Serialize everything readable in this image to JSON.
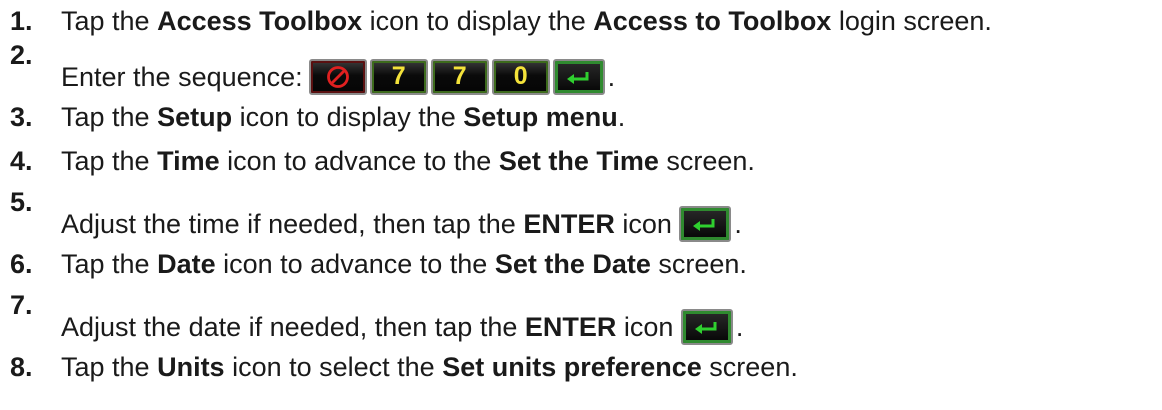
{
  "steps": [
    {
      "number": "1.",
      "parts": [
        "Tap the ",
        "Access Toolbox",
        " icon to display the ",
        "Access to Toolbox",
        " login screen."
      ]
    },
    {
      "number": "2.",
      "parts": [
        "Enter the sequence:"
      ],
      "sequence": [
        "cancel",
        "7",
        "7",
        "0",
        "enter"
      ],
      "tail": "."
    },
    {
      "number": "3.",
      "parts": [
        "Tap the ",
        "Setup",
        " icon to display the ",
        "Setup menu",
        "."
      ]
    },
    {
      "number": "4.",
      "parts": [
        "Tap the ",
        "Time",
        " icon to advance to the ",
        "Set the Time",
        " screen."
      ]
    },
    {
      "number": "5.",
      "parts": [
        "Adjust the time if needed, then tap the ",
        "ENTER",
        " icon "
      ],
      "tail": "."
    },
    {
      "number": "6.",
      "parts": [
        "Tap the ",
        "Date",
        " icon to advance to the ",
        "Set the Date",
        " screen."
      ]
    },
    {
      "number": "7.",
      "parts": [
        "Adjust the date if needed, then tap the ",
        "ENTER",
        " icon "
      ],
      "tail": "."
    },
    {
      "number": "8.",
      "parts": [
        "Tap the ",
        "Units",
        " icon to select the ",
        "Set units preference",
        " screen."
      ]
    }
  ],
  "icons": {
    "cancel": "cancel-key-icon",
    "digit": "digit-key-icon",
    "enter": "enter-key-icon"
  },
  "colors": {
    "digit_text": "#f4e23a",
    "cancel_symbol": "#e02020",
    "enter_arrow": "#2fd02f"
  }
}
